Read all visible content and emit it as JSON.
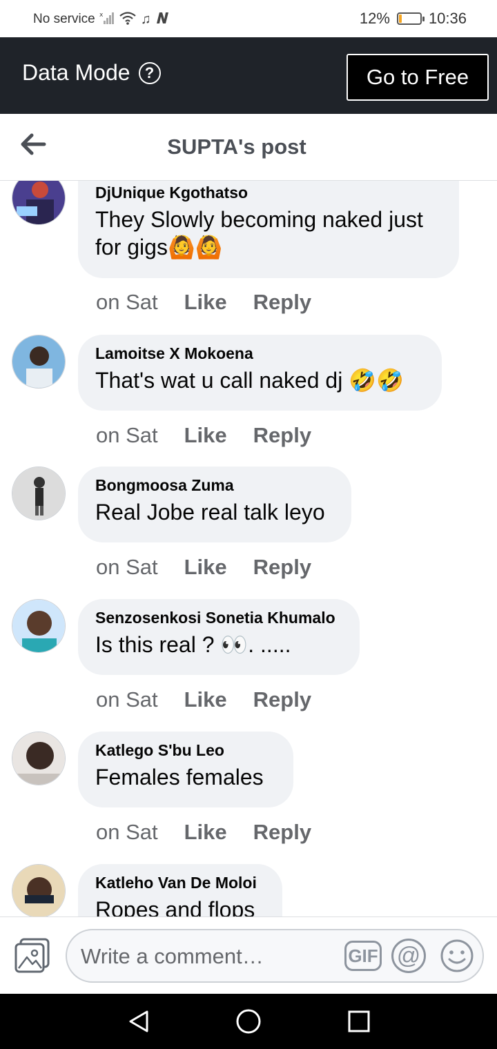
{
  "status_bar": {
    "carrier": "No service",
    "battery": "12%",
    "battery_level": 0.12,
    "time": "10:36"
  },
  "data_mode": {
    "title": "Data Mode",
    "help_icon": "?",
    "go_free_label": "Go to Free"
  },
  "header": {
    "title": "SUPTA's post"
  },
  "comments": [
    {
      "author": "DjUnique Kgothatso",
      "text": "They Slowly becoming naked just for gigs🙆🙆",
      "time": "on Sat",
      "like": "Like",
      "reply": "Reply"
    },
    {
      "author": "Lamoitse X Mokoena",
      "text": "That's wat u call naked dj 🤣🤣",
      "time": "on Sat",
      "like": "Like",
      "reply": "Reply"
    },
    {
      "author": "Bongmoosa Zuma",
      "text": "Real Jobe real talk leyo",
      "time": "on Sat",
      "like": "Like",
      "reply": "Reply"
    },
    {
      "author": "Senzosenkosi Sonetia Khumalo",
      "text": "Is this real ? 👀. .....",
      "time": "on Sat",
      "like": "Like",
      "reply": "Reply"
    },
    {
      "author": "Katlego S'bu Leo",
      "text": "Females females",
      "time": "on Sat",
      "like": "Like",
      "reply": "Reply"
    },
    {
      "author": "Katleho Van De Moloi",
      "text": "Ropes and flops"
    }
  ],
  "composer": {
    "placeholder": "Write a comment…",
    "gif_label": "GIF",
    "at_label": "@"
  },
  "colors": {
    "data_bar_bg": "#1f2329",
    "bubble_bg": "#f0f2f5",
    "secondary_text": "#65676b"
  }
}
